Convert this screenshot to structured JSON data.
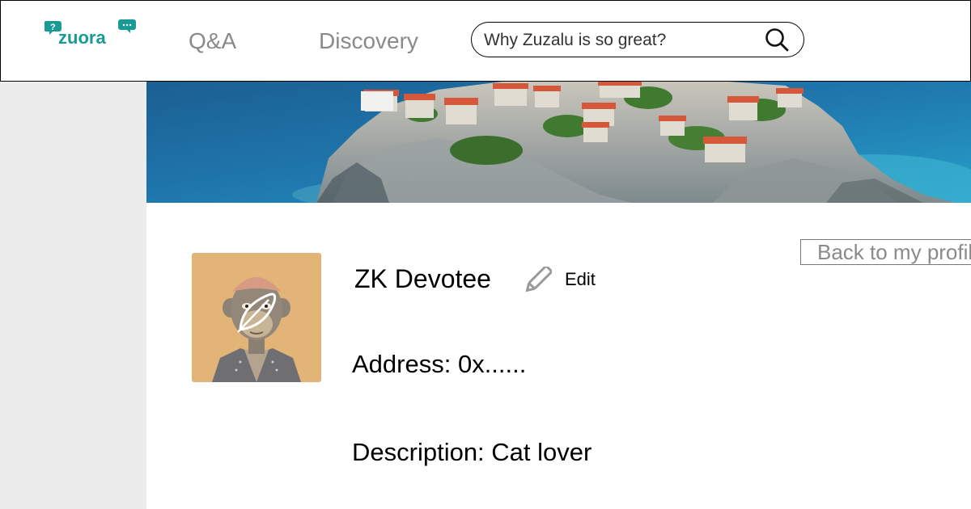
{
  "header": {
    "logo_text": "zuora",
    "nav": {
      "qa": "Q&A",
      "discovery": "Discovery"
    },
    "search": {
      "placeholder": "Why Zuzalu is so great?"
    }
  },
  "profile": {
    "username": "ZK Devotee",
    "edit_label": "Edit",
    "address": "Address: 0x......",
    "description": "Description: Cat lover",
    "back_label": "Back to my profile"
  },
  "colors": {
    "brand_teal": "#1a9a95",
    "nav_text": "#8a8a8a",
    "sidebar_bg": "#ececec",
    "avatar_bg": "#e3b478",
    "sea": "#1d6fa3"
  },
  "icons": {
    "search": "search-icon",
    "edit": "pencil-icon",
    "logo_bubbles": "speech-bubble-icon"
  }
}
